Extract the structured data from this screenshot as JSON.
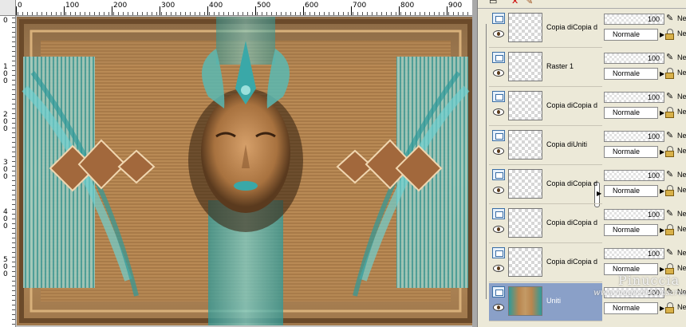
{
  "ruler_top": {
    "labels": [
      "0",
      "100",
      "200",
      "300",
      "400",
      "500",
      "600",
      "700",
      "800",
      "900"
    ]
  },
  "ruler_left": {
    "labels": [
      "0",
      "1 0 0",
      "2 0 0",
      "3 0 0",
      "4 0 0",
      "5 0 0"
    ]
  },
  "toolbar": {
    "icons": [
      "close-icon",
      "brush-icon"
    ]
  },
  "layers": [
    {
      "name": "Copia diCopia d",
      "opacity": "100",
      "blend": "Normale",
      "thumb": "transparent"
    },
    {
      "name": "Raster 1",
      "opacity": "100",
      "blend": "Normale",
      "thumb": "face"
    },
    {
      "name": "Copia diCopia d",
      "opacity": "100",
      "blend": "Normale",
      "thumb": "transparent"
    },
    {
      "name": "Copia diUniti",
      "opacity": "100",
      "blend": "Normale",
      "thumb": "transparent"
    },
    {
      "name": "Copia diCopia d",
      "opacity": "100",
      "blend": "Normale",
      "thumb": "frame"
    },
    {
      "name": "Copia diCopia d",
      "opacity": "100",
      "blend": "Normale",
      "thumb": "diamonds"
    },
    {
      "name": "Copia diCopia d",
      "opacity": "100",
      "blend": "Normale",
      "thumb": "panels"
    },
    {
      "name": "Uniti",
      "opacity": "100",
      "blend": "Normale",
      "thumb": "background",
      "selected": true
    }
  ],
  "prop_suffix": "Ne",
  "watermark": {
    "title": "Pinuccia",
    "sub": "www.magicdreamscreations.it"
  },
  "colors": {
    "selected_row": "#8aa0c8",
    "teal": "#3aa8a8",
    "bronze": "#b8864f"
  }
}
